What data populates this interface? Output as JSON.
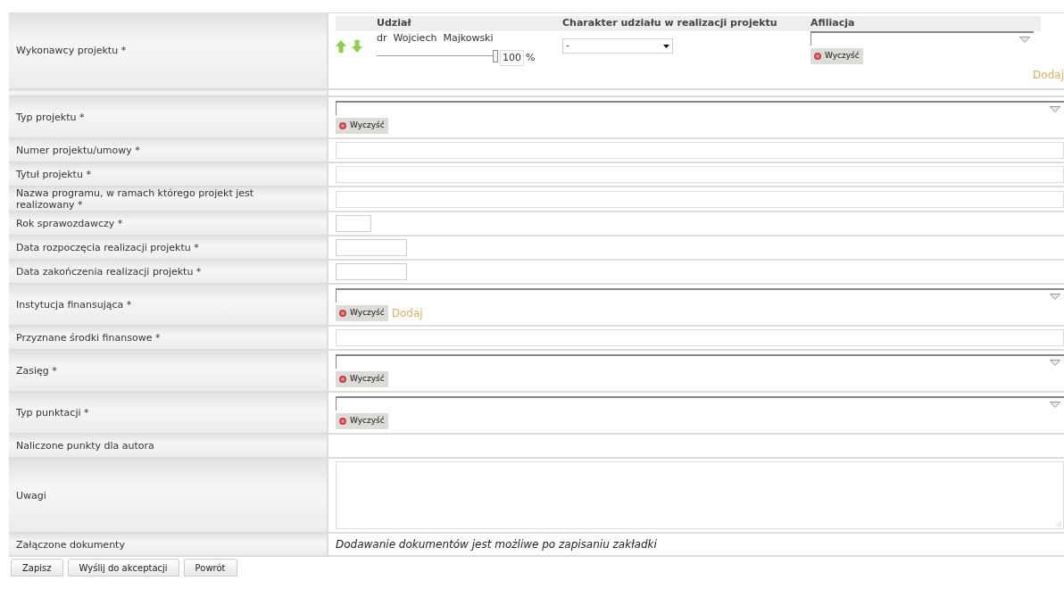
{
  "performers": {
    "label": "Wykonawcy projektu *",
    "columns": [
      "Udział",
      "Charakter udziału w realizacji projektu",
      "Afiliacja"
    ],
    "rows": [
      {
        "name": "dr  Wojciech  Majkowski",
        "level": 1,
        "share": "100",
        "unit": "%",
        "role": "-",
        "clear": "Wyczyść"
      }
    ],
    "add": "Dodaj"
  },
  "fields": [
    {
      "kind": "combo",
      "label": "Typ projektu *",
      "clear": "Wyczyść"
    },
    {
      "kind": "text",
      "label": "Numer projektu/umowy *"
    },
    {
      "kind": "text",
      "label": "Tytuł projektu *"
    },
    {
      "kind": "text",
      "label": "Nazwa programu, w ramach którego projekt jest realizowany *"
    },
    {
      "kind": "year",
      "label": "Rok sprawozdawczy *"
    },
    {
      "kind": "date",
      "label": "Data rozpoczęcia realizacji projektu *"
    },
    {
      "kind": "date",
      "label": "Data zakończenia realizacji projektu *"
    },
    {
      "kind": "combo",
      "label": "Instytucja finansująca *",
      "clear": "Wyczyść",
      "add": "Dodaj"
    },
    {
      "kind": "text",
      "label": "Przyznane środki finansowe *"
    },
    {
      "kind": "combo",
      "label": "Zasięg *",
      "clear": "Wyczyść"
    },
    {
      "kind": "combo",
      "label": "Typ punktacji *",
      "clear": "Wyczyść"
    },
    {
      "kind": "empty",
      "label": "Naliczone punkty dla autora"
    },
    {
      "kind": "textarea",
      "label": "Uwagi"
    },
    {
      "kind": "note",
      "label": "Załączone dokumenty",
      "note": "Dodawanie dokumentów jest możliwe po zapisaniu zakładki"
    }
  ],
  "buttons": [
    "Zapisz",
    "Wyślij do akceptacji",
    "Powrót"
  ]
}
